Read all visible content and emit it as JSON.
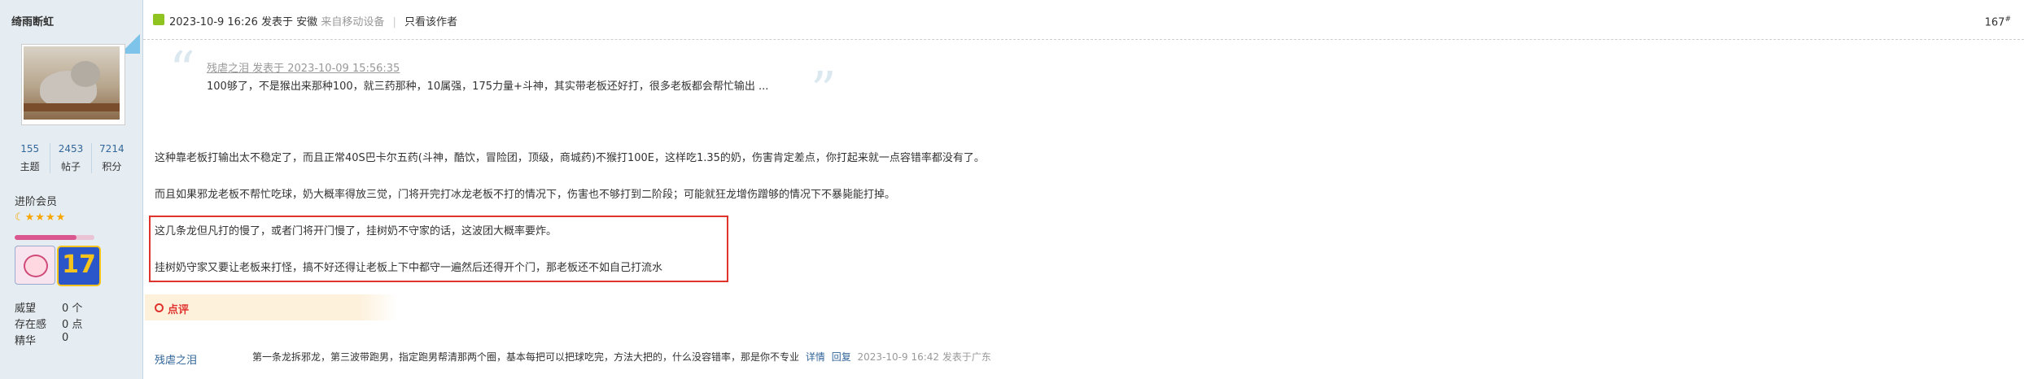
{
  "author": {
    "name": "绮雨断虹",
    "stats": [
      {
        "value": "155",
        "label": "主题"
      },
      {
        "value": "2453",
        "label": "帖子"
      },
      {
        "value": "7214",
        "label": "积分"
      }
    ],
    "rank": "进阶会员",
    "stars": "☾★★★★",
    "rank_progress": 0.78,
    "medal_number": "17",
    "props": [
      {
        "key": "威望",
        "value": "0 个"
      },
      {
        "key": "存在感",
        "value": "0 点"
      },
      {
        "key": "精华",
        "value": "0"
      }
    ]
  },
  "post": {
    "meta_date": "2023-10-9 16:26 发表于",
    "meta_location": "安徽",
    "meta_device": "来自移动设备",
    "only_author": "只看该作者",
    "floor": "167",
    "floor_sup": "#",
    "quote": {
      "author_line": "残虐之泪 发表于 2023-10-09 15:56:35",
      "text": "100够了，不是猴出来那种100，就三药那种，10属强，175力量+斗神，其实带老板还好打，很多老板都会帮忙输出 ..."
    },
    "paragraphs": [
      "这种靠老板打输出太不稳定了，而且正常40S巴卡尔五药(斗神，酷饮，冒险团，顶级，商城药)不猴打100E，这样吃1.35的奶，伤害肯定差点，你打起来就一点容错率都没有了。",
      "而且如果邪龙老板不帮忙吃球，奶大概率得放三觉，门将开完打冰龙老板不打的情况下，伤害也不够打到二阶段；可能就狂龙增伤蹭够的情况下不暴毙能打掉。",
      "这几条龙但凡打的慢了，或者门将开门慢了，挂树奶不守家的话，这波团大概率要炸。",
      "挂树奶守家又要让老板来打怪，搞不好还得让老板上下中都守一遍然后还得开个门，那老板还不如自己打流水"
    ]
  },
  "comments": {
    "label": "点评",
    "items": [
      {
        "user": "残虐之泪",
        "text": "第一条龙拆邪龙，第三波带跑男，指定跑男帮清那两个圈，基本每把可以把球吃完，方法大把的，什么没容错率，那是你不专业",
        "detail": "详情",
        "reply": "回复",
        "time": "2023-10-9 16:42 发表于广东"
      }
    ]
  },
  "colors": {
    "sidebar_bg": "#e5edf2",
    "link": "#336699",
    "highlight_border": "#e0332e",
    "comment_label": "#e0332e"
  }
}
